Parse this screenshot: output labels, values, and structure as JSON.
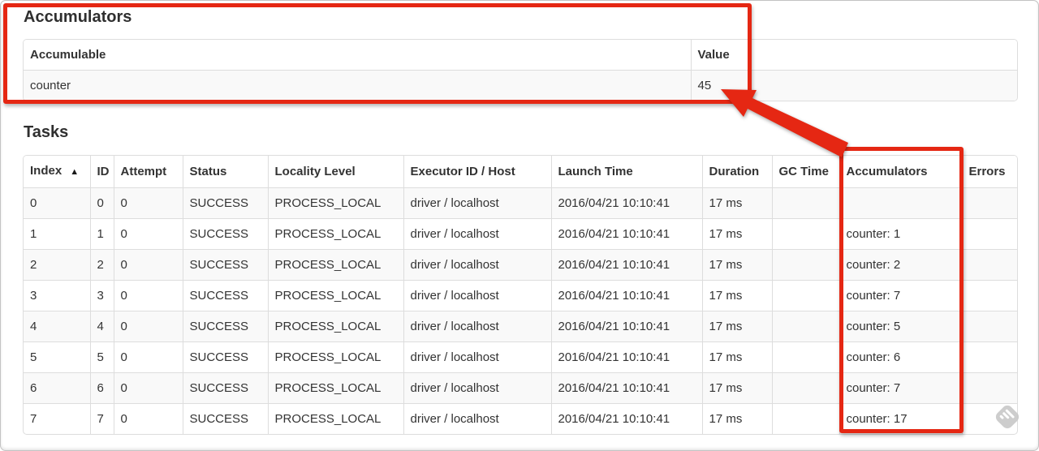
{
  "accumulators_section": {
    "heading": "Accumulators",
    "table": {
      "headers": [
        {
          "label": "Accumulable"
        },
        {
          "label": "Value"
        }
      ],
      "rows": [
        [
          "counter",
          "45"
        ]
      ]
    }
  },
  "tasks_section": {
    "heading": "Tasks",
    "table": {
      "headers": [
        {
          "label": "Index",
          "sort": "▲"
        },
        {
          "label": "ID"
        },
        {
          "label": "Attempt"
        },
        {
          "label": "Status"
        },
        {
          "label": "Locality Level"
        },
        {
          "label": "Executor ID / Host"
        },
        {
          "label": "Launch Time"
        },
        {
          "label": "Duration"
        },
        {
          "label": "GC Time"
        },
        {
          "label": "Accumulators"
        },
        {
          "label": "Errors"
        }
      ],
      "rows": [
        [
          "0",
          "0",
          "0",
          "SUCCESS",
          "PROCESS_LOCAL",
          "driver / localhost",
          "2016/04/21 10:10:41",
          "17 ms",
          "",
          "",
          ""
        ],
        [
          "1",
          "1",
          "0",
          "SUCCESS",
          "PROCESS_LOCAL",
          "driver / localhost",
          "2016/04/21 10:10:41",
          "17 ms",
          "",
          "counter: 1",
          ""
        ],
        [
          "2",
          "2",
          "0",
          "SUCCESS",
          "PROCESS_LOCAL",
          "driver / localhost",
          "2016/04/21 10:10:41",
          "17 ms",
          "",
          "counter: 2",
          ""
        ],
        [
          "3",
          "3",
          "0",
          "SUCCESS",
          "PROCESS_LOCAL",
          "driver / localhost",
          "2016/04/21 10:10:41",
          "17 ms",
          "",
          "counter: 7",
          ""
        ],
        [
          "4",
          "4",
          "0",
          "SUCCESS",
          "PROCESS_LOCAL",
          "driver / localhost",
          "2016/04/21 10:10:41",
          "17 ms",
          "",
          "counter: 5",
          ""
        ],
        [
          "5",
          "5",
          "0",
          "SUCCESS",
          "PROCESS_LOCAL",
          "driver / localhost",
          "2016/04/21 10:10:41",
          "17 ms",
          "",
          "counter: 6",
          ""
        ],
        [
          "6",
          "6",
          "0",
          "SUCCESS",
          "PROCESS_LOCAL",
          "driver / localhost",
          "2016/04/21 10:10:41",
          "17 ms",
          "",
          "counter: 7",
          ""
        ],
        [
          "7",
          "7",
          "0",
          "SUCCESS",
          "PROCESS_LOCAL",
          "driver / localhost",
          "2016/04/21 10:10:41",
          "17 ms",
          "",
          "counter: 17",
          ""
        ]
      ]
    }
  },
  "annotations": {
    "highlight_color": "#e52713",
    "sort_ascending_icon": "▲",
    "watermark_icon": "annotation-app-watermark"
  },
  "colors": {
    "table_border": "#dddddd",
    "stripe_row": "#f9f9f9",
    "text": "#333333"
  }
}
